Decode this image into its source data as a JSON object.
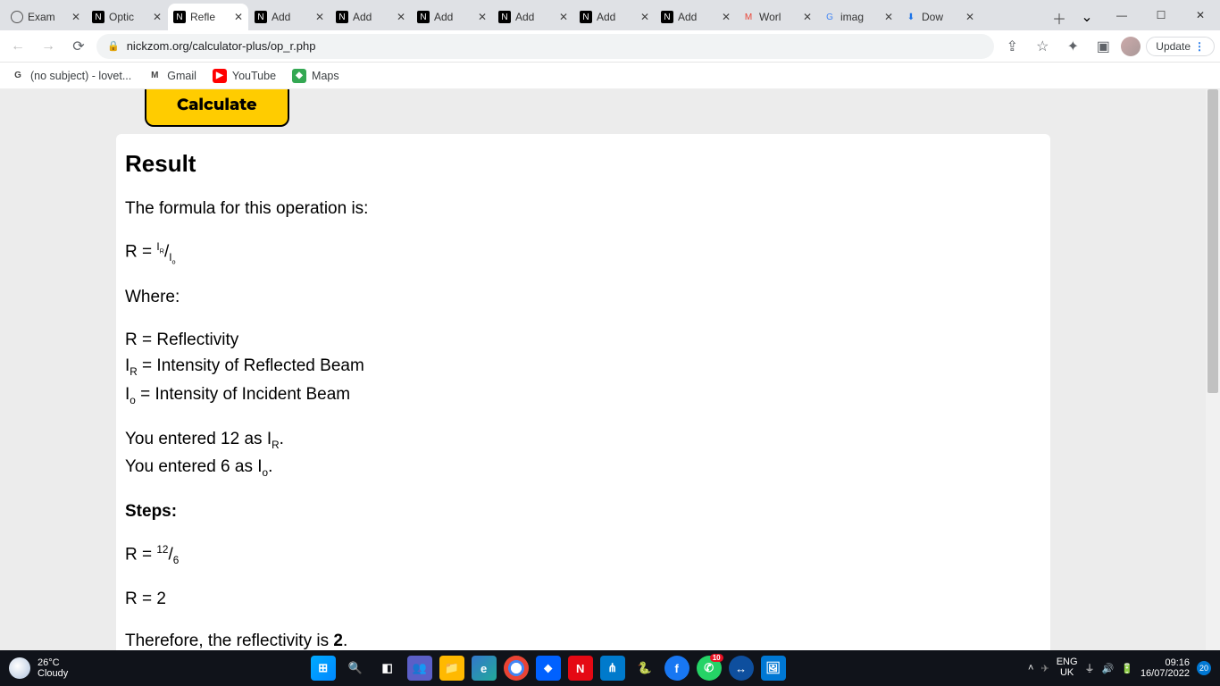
{
  "tabs": [
    {
      "label": "Exam",
      "fav": "globe"
    },
    {
      "label": "Optic",
      "fav": "N"
    },
    {
      "label": "Refle",
      "fav": "N",
      "active": true
    },
    {
      "label": "Add",
      "fav": "N"
    },
    {
      "label": "Add",
      "fav": "N"
    },
    {
      "label": "Add",
      "fav": "N"
    },
    {
      "label": "Add",
      "fav": "N"
    },
    {
      "label": "Add",
      "fav": "N"
    },
    {
      "label": "Add",
      "fav": "N"
    },
    {
      "label": "Worl",
      "fav": "M"
    },
    {
      "label": "imag",
      "fav": "G"
    },
    {
      "label": "Dow",
      "fav": "D"
    }
  ],
  "omnibox": {
    "url": "nickzom.org/calculator-plus/op_r.php"
  },
  "update": "Update",
  "bookmarks": [
    {
      "label": "(no subject) - lovet...",
      "ico": "G",
      "bg": "#fff"
    },
    {
      "label": "Gmail",
      "ico": "M",
      "bg": "#fff"
    },
    {
      "label": "YouTube",
      "ico": "▶",
      "bg": "#f00",
      "fg": "#fff"
    },
    {
      "label": "Maps",
      "ico": "◆",
      "bg": "#34a853",
      "fg": "#fff"
    }
  ],
  "calculate_label": "Calculate",
  "result": {
    "heading": "Result",
    "formula_intro": "The formula for this operation is:",
    "where": "Where:",
    "def_r": "R = Reflectivity",
    "def_ir_pre": "I",
    "def_ir_sub": "R",
    "def_ir_post": " = Intensity of Reflected Beam",
    "def_io_pre": "I",
    "def_io_sub": "o",
    "def_io_post": " = Intensity of Incident Beam",
    "entered_ir_pre": "You entered 12 as I",
    "entered_ir_sub": "R",
    "entered_ir_post": ".",
    "entered_io_pre": "You entered 6 as I",
    "entered_io_sub": "o",
    "entered_io_post": ".",
    "steps": "Steps:",
    "step_num": "12",
    "step_den": "6",
    "answer": "R = 2",
    "conclusion_pre": "Therefore, the reflectivity is ",
    "conclusion_val": "2",
    "conclusion_post": "."
  },
  "weather": {
    "temp": "26°C",
    "cond": "Cloudy"
  },
  "tray": {
    "lang1": "ENG",
    "lang2": "UK",
    "time": "09:16",
    "date": "16/07/2022",
    "notif": "20"
  },
  "task_badge": "10"
}
